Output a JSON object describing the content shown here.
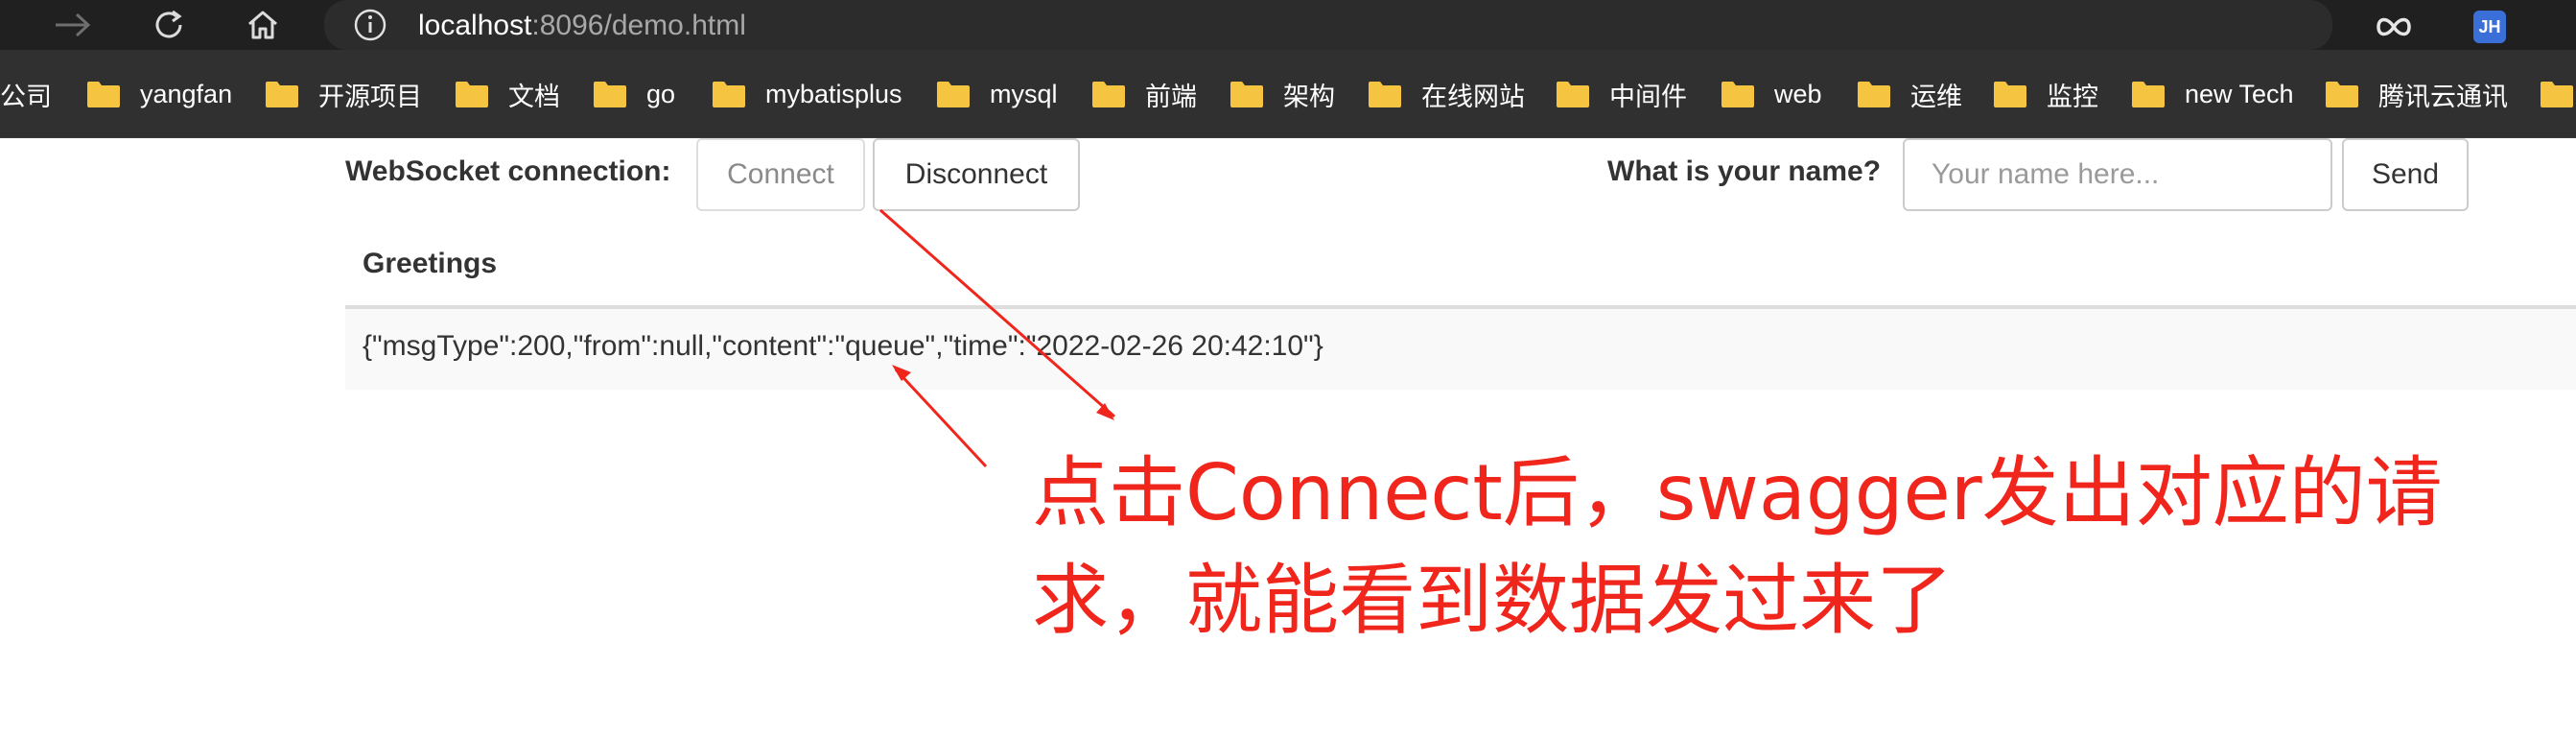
{
  "browser": {
    "url_host": "localhost",
    "url_rest": ":8096/demo.html",
    "icons": [
      "forward-arrow-icon",
      "refresh-icon",
      "home-icon",
      "info-icon",
      "favorite-star-icon",
      "extension-infinity-icon"
    ],
    "profile_initials": "JH"
  },
  "bookmarks": [
    "公司",
    "yangfan",
    "开源项目",
    "文档",
    "go",
    "mybatisplus",
    "mysql",
    "前端",
    "架构",
    "在线网站",
    "中间件",
    "web",
    "运维",
    "监控",
    "new Tech",
    "腾讯云通讯"
  ],
  "page": {
    "connection_label": "WebSocket connection:",
    "connect_label": "Connect",
    "disconnect_label": "Disconnect",
    "name_label": "What is your name?",
    "name_placeholder": "Your name here...",
    "send_label": "Send",
    "greetings_header": "Greetings",
    "greetings_rows": [
      "{\"msgType\":200,\"from\":null,\"content\":\"queue\",\"time\":\"2022-02-26 20:42:10\"}"
    ]
  },
  "annotation": {
    "text": "点击Connect后，swagger发出对应的请求，就能看到数据发过来了",
    "color": "#f0261d"
  }
}
